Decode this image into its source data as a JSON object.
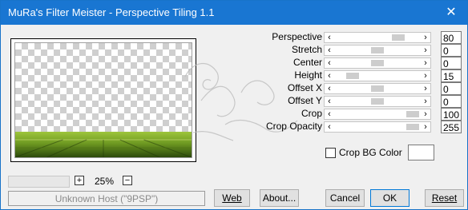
{
  "window": {
    "title": "MuRa's Filter Meister - Perspective Tiling 1.1",
    "close_label": "✕"
  },
  "zoom": {
    "plus_label": "+",
    "minus_label": "−",
    "value": "25%"
  },
  "host": {
    "text": "Unknown Host (\"9PSP\")"
  },
  "parameters": [
    {
      "label": "Perspective",
      "value": "80",
      "level": 0.8
    },
    {
      "label": "Stretch",
      "value": "0",
      "level": 0.5
    },
    {
      "label": "Center",
      "value": "0",
      "level": 0.5
    },
    {
      "label": "Height",
      "value": "15",
      "level": 0.15
    },
    {
      "label": "Offset X",
      "value": "0",
      "level": 0.5
    },
    {
      "label": "Offset Y",
      "value": "0",
      "level": 0.5
    },
    {
      "label": "Crop",
      "value": "100",
      "level": 1.0
    },
    {
      "label": "Crop Opacity",
      "value": "255",
      "level": 1.0
    }
  ],
  "crop_bg": {
    "label": "Crop BG Color",
    "checked": false,
    "color": "#ffffff"
  },
  "buttons": {
    "web": "Web",
    "about": "About...",
    "cancel": "Cancel",
    "ok": "OK",
    "reset": "Reset"
  },
  "colors": {
    "titlebar": "#1976d2",
    "floor_dark": "#2f4a12",
    "floor_light": "#8bb832"
  }
}
